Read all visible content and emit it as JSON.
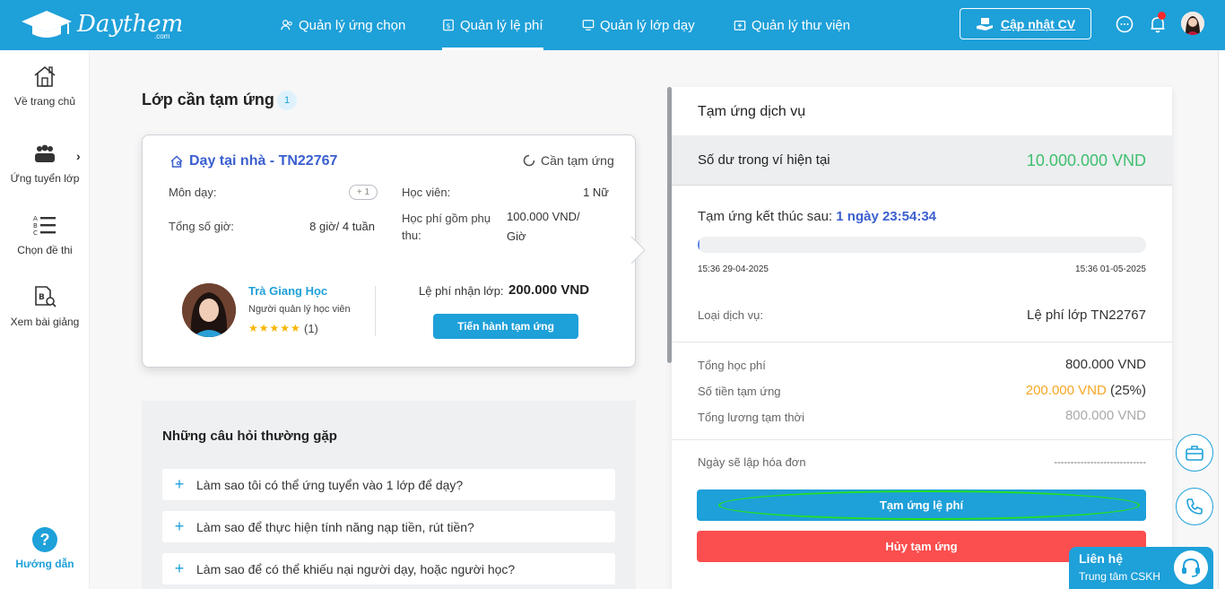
{
  "brand": {
    "name": "Daythem",
    "suffix": ".com"
  },
  "nav": [
    {
      "label": "Quản lý ứng chọn",
      "icon": "users-icon",
      "active": false
    },
    {
      "label": "Quản lý lệ phí",
      "icon": "fee-icon",
      "active": true
    },
    {
      "label": "Quản lý lớp dạy",
      "icon": "classroom-icon",
      "active": false
    },
    {
      "label": "Quản lý thư viện",
      "icon": "library-icon",
      "active": false
    }
  ],
  "header": {
    "cv_button": "Cập nhật CV"
  },
  "sidebar": {
    "items": [
      {
        "label": "Về trang chủ",
        "icon": "home-icon"
      },
      {
        "label": "Ứng tuyển lớp",
        "icon": "group-icon"
      },
      {
        "label": "Chọn đề thi",
        "icon": "list-icon"
      },
      {
        "label": "Xem bài giảng",
        "icon": "lecture-icon"
      }
    ],
    "help_label": "Hướng dẫn",
    "help_symbol": "?"
  },
  "main": {
    "title": "Lớp cần tạm ứng",
    "count": "1",
    "card": {
      "title": "Dạy tại nhà - TN22767",
      "status": "Cần tạm ứng",
      "subject_label": "Môn dạy:",
      "subject_more": "+ 1",
      "hours_label": "Tổng số giờ:",
      "hours_value": "8 giờ/ 4 tuần",
      "student_label": "Học viên:",
      "student_value": "1 Nữ",
      "tuition_label_1": "Học phí gồm phụ",
      "tuition_label_2": "thu:",
      "tuition_value_1": "100.000 VND/",
      "tuition_value_2": "Giờ",
      "manager_name": "Trà Giang Học",
      "manager_role": "Người quản lý học viên",
      "rating_stars": "★★★★★",
      "rating_count": "(1)",
      "fee_label": "Lệ phí nhận lớp:",
      "fee_value": "200.000 VND",
      "advance_button": "Tiến hành tạm ứng"
    },
    "faq": {
      "title": "Những câu hỏi thường gặp",
      "items": [
        "Làm sao tôi có thể ứng tuyển vào 1 lớp để dạy?",
        "Làm sao để thực hiện tính năng nạp tiền, rút tiền?",
        "Làm sao để có thể khiếu nại người dạy, hoặc người học?"
      ],
      "plus": "+"
    }
  },
  "panel": {
    "title": "Tạm ứng dịch vụ",
    "balance_label": "Số dư trong ví hiện tại",
    "balance_value": "10.000.000 VND",
    "countdown_label": "Tạm ứng kết thúc sau: ",
    "countdown_value": "1 ngày 23:54:34",
    "progress": 0.004,
    "start_time": "15:36 29-04-2025",
    "end_time": "15:36 01-05-2025",
    "service_label": "Loại dịch vụ:",
    "service_value": "Lệ phí lớp TN22767",
    "total_fee_label": "Tổng học phí",
    "total_fee_value": "800.000 VND",
    "advance_label": "Số tiền tạm ứng",
    "advance_value": "200.000 VND",
    "advance_pct": "(25%)",
    "temp_salary_label": "Tổng lương tạm thời",
    "temp_salary_value": "800.000 VND",
    "invoice_label": "Ngày sẽ lập hóa đơn",
    "invoice_value": "----------------------------",
    "primary_button": "Tạm ứng lệ phí",
    "cancel_button": "Hủy tạm ứng"
  },
  "contact": {
    "title": "Liên hệ",
    "subtitle": "Trung tâm CSKH"
  },
  "colors": {
    "brand": "#1ea0d9",
    "success": "#3fbf6f",
    "warning": "#f5a623",
    "danger": "#fb4e4e",
    "link": "#3a5fcf",
    "highlight": "#22e022"
  }
}
